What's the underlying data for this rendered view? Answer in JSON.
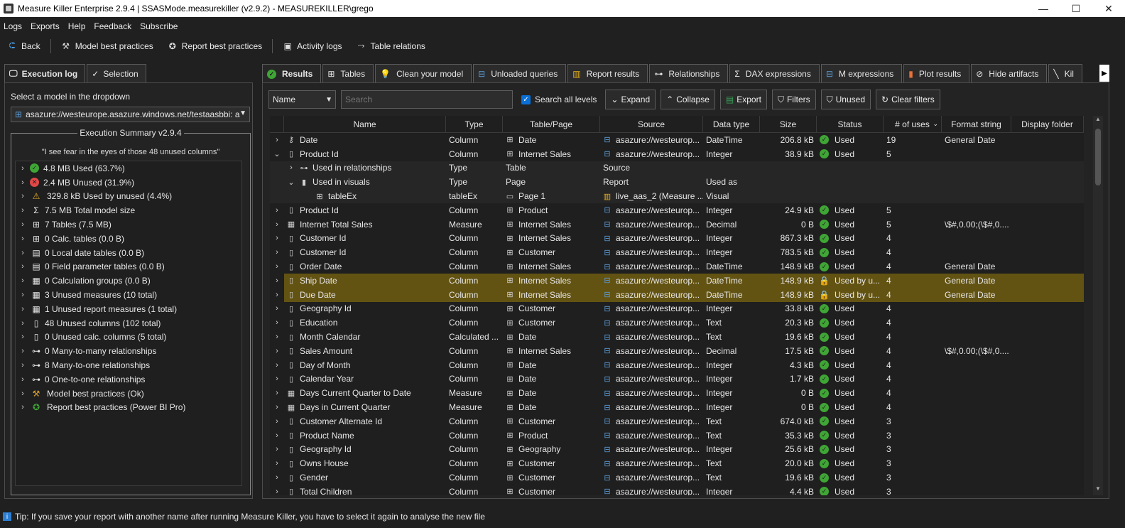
{
  "window": {
    "title": "Measure Killer Enterprise 2.9.4 | SSASMode.measurekiller (v2.9.2) - MEASUREKILLER\\grego",
    "minimize": "—",
    "maximize": "☐",
    "close": "✕"
  },
  "menu": [
    "Logs",
    "Exports",
    "Help",
    "Feedback",
    "Subscribe"
  ],
  "toolbar": {
    "back": "Back",
    "model_best_practices": "Model best practices",
    "report_best_practices": "Report best practices",
    "activity_logs": "Activity logs",
    "table_relations": "Table relations"
  },
  "left": {
    "tabs": [
      "Execution log",
      "Selection"
    ],
    "select_label": "Select a model in the dropdown",
    "model_value": "asazure://westeurope.asazure.windows.net/testaasbbi: a",
    "summary_title": "Execution Summary v2.9.4",
    "quote": "\"I see fear in the eyes of those 48 unused columns\"",
    "items": [
      {
        "icon": "check-circle",
        "label": "4.8 MB Used (63.7%)"
      },
      {
        "icon": "x-circle",
        "label": "2.4 MB Unused (31.9%)"
      },
      {
        "icon": "warning",
        "label": "329.8 kB Used by unused (4.4%)"
      },
      {
        "icon": "sigma",
        "label": "7.5 MB Total model size"
      },
      {
        "icon": "table",
        "label": "7 Tables (7.5 MB)"
      },
      {
        "icon": "calc-table",
        "label": "0 Calc. tables (0.0 B)"
      },
      {
        "icon": "date-table",
        "label": "0 Local date tables (0.0 B)"
      },
      {
        "icon": "field-param",
        "label": "0 Field parameter tables (0.0 B)"
      },
      {
        "icon": "calc-group",
        "label": "0 Calculation groups (0.0 B)"
      },
      {
        "icon": "measure",
        "label": "3 Unused measures (10 total)"
      },
      {
        "icon": "measure",
        "label": "1 Unused report measures (1 total)"
      },
      {
        "icon": "column",
        "label": "48 Unused columns (102 total)"
      },
      {
        "icon": "calc-column",
        "label": "0 Unused calc. columns (5 total)"
      },
      {
        "icon": "relationship",
        "label": "0 Many-to-many relationships"
      },
      {
        "icon": "relationship",
        "label": "8 Many-to-one relationships"
      },
      {
        "icon": "relationship",
        "label": "0 One-to-one relationships"
      },
      {
        "icon": "hammer",
        "label": "Model best practices (Ok)"
      },
      {
        "icon": "award",
        "label": "Report best practices (Power BI Pro)"
      }
    ]
  },
  "right": {
    "tabs": [
      "Results",
      "Tables",
      "Clean your model",
      "Unloaded queries",
      "Report results",
      "Relationships",
      "DAX expressions",
      "M expressions",
      "Plot results",
      "Hide artifacts",
      "Kil"
    ],
    "filter": {
      "name_dropdown": "Name",
      "search_placeholder": "Search",
      "search_all_levels": "Search all levels",
      "expand": "Expand",
      "collapse": "Collapse",
      "export": "Export",
      "filters": "Filters",
      "unused": "Unused",
      "clear_filters": "Clear filters"
    },
    "columns": [
      "Name",
      "Type",
      "Table/Page",
      "Source",
      "Data type",
      "Size",
      "Status",
      "# of uses",
      "Format string",
      "Display folder"
    ],
    "rows": [
      {
        "chev": "›",
        "indent": 0,
        "icon": "key",
        "name": "Date",
        "type": "Column",
        "table": "Date",
        "source": "asazure://westeurop...",
        "dtype": "DateTime",
        "size": "206.8 kB",
        "status": "Used",
        "uses": "19",
        "format": "General Date",
        "hl": false
      },
      {
        "chev": "⌄",
        "indent": 0,
        "icon": "column",
        "name": "Product Id",
        "type": "Column",
        "table": "Internet Sales",
        "source": "asazure://westeurop...",
        "dtype": "Integer",
        "size": "38.9 kB",
        "status": "Used",
        "uses": "5",
        "format": "",
        "hl": false
      },
      {
        "chev": "›",
        "indent": 1,
        "icon": "relationship",
        "name": "Used in relationships",
        "type": "Type",
        "table": "Table",
        "source": "Source",
        "dtype": "",
        "size": "",
        "status": "",
        "uses": "",
        "format": "",
        "hl": false,
        "child": true,
        "plain": true
      },
      {
        "chev": "⌄",
        "indent": 1,
        "icon": "visual",
        "name": "Used in visuals",
        "type": "Type",
        "table": "Page",
        "source": "Report",
        "dtype": "Used as",
        "size": "",
        "status": "",
        "uses": "",
        "format": "",
        "hl": false,
        "child": true,
        "plain": true
      },
      {
        "chev": "",
        "indent": 2,
        "icon": "table",
        "name": "tableEx",
        "type": "tableEx",
        "table": "Page 1",
        "source": "live_aas_2 (Measure ...",
        "dtype": "Visual",
        "size": "",
        "status": "",
        "uses": "",
        "format": "",
        "hl": false,
        "child": true,
        "tableIcon": "page",
        "srcIcon": "report"
      },
      {
        "chev": "›",
        "indent": 0,
        "icon": "column",
        "name": "Product Id",
        "type": "Column",
        "table": "Product",
        "source": "asazure://westeurop...",
        "dtype": "Integer",
        "size": "24.9 kB",
        "status": "Used",
        "uses": "5",
        "format": "",
        "hl": false
      },
      {
        "chev": "›",
        "indent": 0,
        "icon": "measure",
        "name": "Internet Total Sales",
        "type": "Measure",
        "table": "Internet Sales",
        "source": "asazure://westeurop...",
        "dtype": "Decimal",
        "size": "0 B",
        "status": "Used",
        "uses": "5",
        "format": "\\$#,0.00;(\\$#,0....",
        "hl": false
      },
      {
        "chev": "›",
        "indent": 0,
        "icon": "column",
        "name": "Customer Id",
        "type": "Column",
        "table": "Internet Sales",
        "source": "asazure://westeurop...",
        "dtype": "Integer",
        "size": "867.3 kB",
        "status": "Used",
        "uses": "4",
        "format": "",
        "hl": false
      },
      {
        "chev": "›",
        "indent": 0,
        "icon": "column",
        "name": "Customer Id",
        "type": "Column",
        "table": "Customer",
        "source": "asazure://westeurop...",
        "dtype": "Integer",
        "size": "783.5 kB",
        "status": "Used",
        "uses": "4",
        "format": "",
        "hl": false
      },
      {
        "chev": "›",
        "indent": 0,
        "icon": "column",
        "name": "Order Date",
        "type": "Column",
        "table": "Internet Sales",
        "source": "asazure://westeurop...",
        "dtype": "DateTime",
        "size": "148.9 kB",
        "status": "Used",
        "uses": "4",
        "format": "General Date",
        "hl": false
      },
      {
        "chev": "›",
        "indent": 0,
        "icon": "column",
        "name": "Ship Date",
        "type": "Column",
        "table": "Internet Sales",
        "source": "asazure://westeurop...",
        "dtype": "DateTime",
        "size": "148.9 kB",
        "status": "Used by u...",
        "uses": "4",
        "format": "General Date",
        "hl": true,
        "lock": true
      },
      {
        "chev": "›",
        "indent": 0,
        "icon": "column",
        "name": "Due Date",
        "type": "Column",
        "table": "Internet Sales",
        "source": "asazure://westeurop...",
        "dtype": "DateTime",
        "size": "148.9 kB",
        "status": "Used by u...",
        "uses": "4",
        "format": "General Date",
        "hl": true,
        "lock": true
      },
      {
        "chev": "›",
        "indent": 0,
        "icon": "column",
        "name": "Geography Id",
        "type": "Column",
        "table": "Customer",
        "source": "asazure://westeurop...",
        "dtype": "Integer",
        "size": "33.8 kB",
        "status": "Used",
        "uses": "4",
        "format": "",
        "hl": false
      },
      {
        "chev": "›",
        "indent": 0,
        "icon": "column",
        "name": "Education",
        "type": "Column",
        "table": "Customer",
        "source": "asazure://westeurop...",
        "dtype": "Text",
        "size": "20.3 kB",
        "status": "Used",
        "uses": "4",
        "format": "",
        "hl": false
      },
      {
        "chev": "›",
        "indent": 0,
        "icon": "calc-column",
        "name": "Month Calendar",
        "type": "Calculated ...",
        "table": "Date",
        "source": "asazure://westeurop...",
        "dtype": "Text",
        "size": "19.6 kB",
        "status": "Used",
        "uses": "4",
        "format": "",
        "hl": false
      },
      {
        "chev": "›",
        "indent": 0,
        "icon": "column",
        "name": "Sales Amount",
        "type": "Column",
        "table": "Internet Sales",
        "source": "asazure://westeurop...",
        "dtype": "Decimal",
        "size": "17.5 kB",
        "status": "Used",
        "uses": "4",
        "format": "\\$#,0.00;(\\$#,0....",
        "hl": false
      },
      {
        "chev": "›",
        "indent": 0,
        "icon": "column",
        "name": "Day of Month",
        "type": "Column",
        "table": "Date",
        "source": "asazure://westeurop...",
        "dtype": "Integer",
        "size": "4.3 kB",
        "status": "Used",
        "uses": "4",
        "format": "",
        "hl": false
      },
      {
        "chev": "›",
        "indent": 0,
        "icon": "column",
        "name": "Calendar Year",
        "type": "Column",
        "table": "Date",
        "source": "asazure://westeurop...",
        "dtype": "Integer",
        "size": "1.7 kB",
        "status": "Used",
        "uses": "4",
        "format": "",
        "hl": false
      },
      {
        "chev": "›",
        "indent": 0,
        "icon": "measure",
        "name": "Days Current Quarter to Date",
        "type": "Measure",
        "table": "Date",
        "source": "asazure://westeurop...",
        "dtype": "Integer",
        "size": "0 B",
        "status": "Used",
        "uses": "4",
        "format": "",
        "hl": false
      },
      {
        "chev": "›",
        "indent": 0,
        "icon": "measure",
        "name": "Days in Current Quarter",
        "type": "Measure",
        "table": "Date",
        "source": "asazure://westeurop...",
        "dtype": "Integer",
        "size": "0 B",
        "status": "Used",
        "uses": "4",
        "format": "",
        "hl": false
      },
      {
        "chev": "›",
        "indent": 0,
        "icon": "column",
        "name": "Customer Alternate Id",
        "type": "Column",
        "table": "Customer",
        "source": "asazure://westeurop...",
        "dtype": "Text",
        "size": "674.0 kB",
        "status": "Used",
        "uses": "3",
        "format": "",
        "hl": false
      },
      {
        "chev": "›",
        "indent": 0,
        "icon": "column",
        "name": "Product Name",
        "type": "Column",
        "table": "Product",
        "source": "asazure://westeurop...",
        "dtype": "Text",
        "size": "35.3 kB",
        "status": "Used",
        "uses": "3",
        "format": "",
        "hl": false
      },
      {
        "chev": "›",
        "indent": 0,
        "icon": "column",
        "name": "Geography Id",
        "type": "Column",
        "table": "Geography",
        "source": "asazure://westeurop...",
        "dtype": "Integer",
        "size": "25.6 kB",
        "status": "Used",
        "uses": "3",
        "format": "",
        "hl": false
      },
      {
        "chev": "›",
        "indent": 0,
        "icon": "column",
        "name": "Owns House",
        "type": "Column",
        "table": "Customer",
        "source": "asazure://westeurop...",
        "dtype": "Text",
        "size": "20.0 kB",
        "status": "Used",
        "uses": "3",
        "format": "",
        "hl": false
      },
      {
        "chev": "›",
        "indent": 0,
        "icon": "column",
        "name": "Gender",
        "type": "Column",
        "table": "Customer",
        "source": "asazure://westeurop...",
        "dtype": "Text",
        "size": "19.6 kB",
        "status": "Used",
        "uses": "3",
        "format": "",
        "hl": false
      },
      {
        "chev": "›",
        "indent": 0,
        "icon": "column",
        "name": "Total Children",
        "type": "Column",
        "table": "Customer",
        "source": "asazure://westeurop...",
        "dtype": "Integer",
        "size": "4.4 kB",
        "status": "Used",
        "uses": "3",
        "format": "",
        "hl": false
      }
    ]
  },
  "tip": {
    "icon": "info-icon",
    "text": "Tip: If you save your report with another name after running Measure Killer, you have to select it again to analyse the new file"
  },
  "colors": {
    "used_green": "#3fa535",
    "unused_red": "#e04848",
    "warning_yellow": "#e8b020",
    "highlight_row": "#635312",
    "accent_blue": "#0a6fd6"
  }
}
